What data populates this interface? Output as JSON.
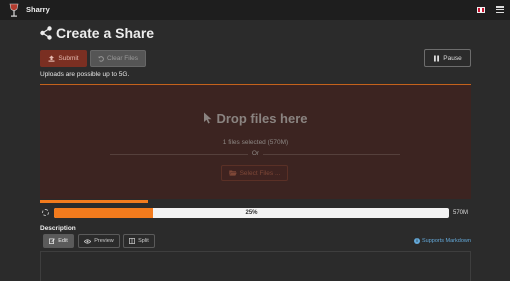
{
  "app": {
    "name": "Sharry",
    "logo_icon": "wine-glass-logo",
    "language_icon": "uk-flag-icon",
    "menu_icon": "hamburger-menu-icon"
  },
  "page": {
    "title": "Create a Share",
    "title_icon": "share-icon"
  },
  "toolbar": {
    "submit_label": "Submit",
    "clear_label": "Clear Files",
    "pause_label": "Pause"
  },
  "uploads_note": "Uploads are possible up to 5G.",
  "dropzone": {
    "title": "Drop files here",
    "files_selected": "1 files selected (570M)",
    "or_text": "Or",
    "select_files_label": "Select Files ..."
  },
  "upload_progress": {
    "percent": 25,
    "percent_label": "25%",
    "size": "570M"
  },
  "description": {
    "label": "Description",
    "tabs": [
      {
        "label": "Edit"
      },
      {
        "label": "Preview"
      },
      {
        "label": "Split"
      }
    ],
    "markdown_link": "Supports Markdown"
  },
  "colors": {
    "accent": "#f37b1d",
    "submit_bg": "#7a2f22",
    "dropzone_bg": "#3c2421",
    "link": "#63a8d8"
  }
}
